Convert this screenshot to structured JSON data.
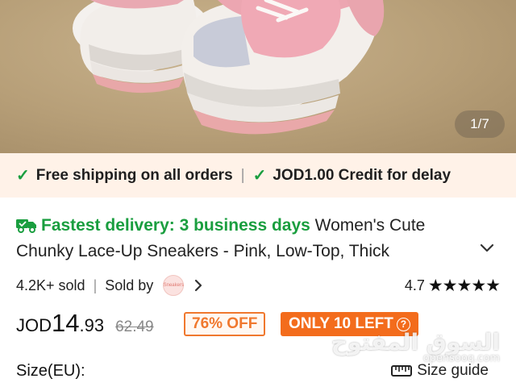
{
  "image": {
    "counter": "1/7"
  },
  "shipping": {
    "free_shipping": "Free shipping on all orders",
    "separator": "|",
    "credit": "JOD1.00 Credit for delay"
  },
  "product": {
    "delivery": "Fastest delivery: 3 business days",
    "title_line1": "Women's Cute",
    "title_line2": "Chunky Lace-Up Sneakers - Pink, Low-Top, Thick",
    "title_fade": "…",
    "sold": "4.2K+ sold",
    "sold_by": "Sold by",
    "store_logo_text": "Sneakers",
    "rating": "4.7",
    "stars": "★★★★★"
  },
  "price": {
    "currency": "JOD",
    "whole": "14",
    "cents": ".93",
    "original": "62.49",
    "discount": "76% OFF",
    "stock": "ONLY 10 LEFT"
  },
  "size": {
    "label": "Size(EU):",
    "guide": "Size guide"
  },
  "watermark": {
    "arabic": "السوق المفتوح",
    "latin": "opensooq.com"
  },
  "colors": {
    "green": "#1a9e3f",
    "orange": "#f36c1c",
    "banner_bg": "#fff2e8"
  }
}
